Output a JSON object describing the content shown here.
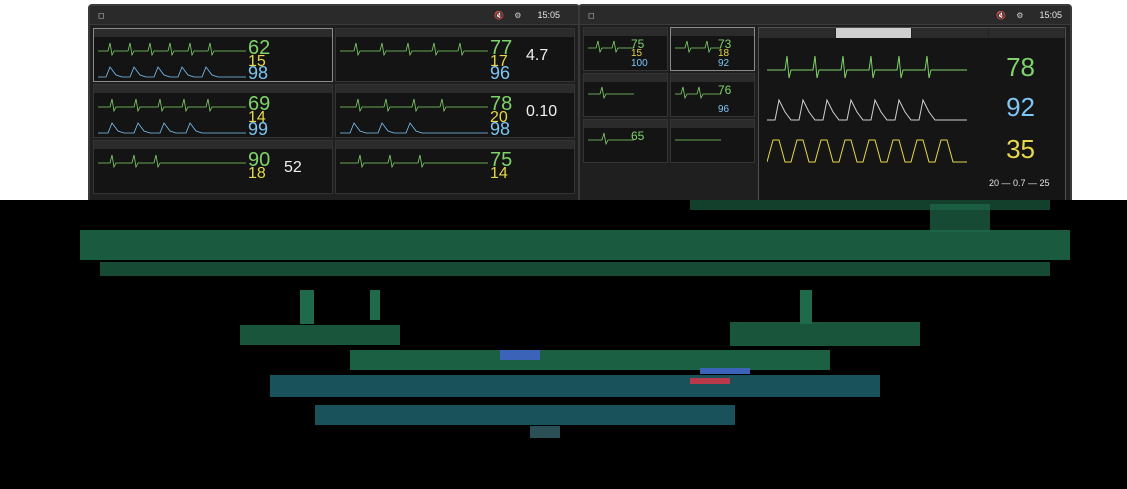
{
  "left_monitor": {
    "brand": "",
    "buttons": [
      "",
      ""
    ],
    "clock": "15:05",
    "date": "",
    "tiles": [
      {
        "hr": "62",
        "rr": "15",
        "sp": "98",
        "extra": ""
      },
      {
        "hr": "77",
        "rr": "17",
        "sp": "96",
        "extra": "4.7"
      },
      {
        "hr": "69",
        "rr": "14",
        "sp": "99",
        "extra": ""
      },
      {
        "hr": "78",
        "rr": "20",
        "sp": "98",
        "extra": "0.10"
      },
      {
        "hr": "90",
        "rr": "18",
        "sp": "",
        "extra": "52"
      },
      {
        "hr": "75",
        "rr": "14",
        "sp": "",
        "extra": ""
      }
    ]
  },
  "right_monitor": {
    "brand": "",
    "clock": "15:05",
    "mini_tiles": [
      {
        "hr": "75",
        "rr": "15",
        "sp": "100"
      },
      {
        "hr": "73",
        "rr": "18",
        "sp": "92"
      },
      {
        "hr": "",
        "rr": "",
        "sp": ""
      },
      {
        "hr": "76",
        "rr": "",
        "sp": "96"
      },
      {
        "hr": "65",
        "rr": "",
        "sp": ""
      },
      {
        "hr": "",
        "rr": "",
        "sp": ""
      }
    ],
    "detail": {
      "tabs": [
        "",
        "",
        "",
        ""
      ],
      "hr": "78",
      "sp": "92",
      "rr": "35",
      "pressure": "20 — 0.7 — 25"
    }
  },
  "colors": {
    "hr": "#7fd36a",
    "rr": "#e6d84a",
    "spo2": "#7ec6f5",
    "overlay": "#000000",
    "glitch_green": "#1f6a4a",
    "glitch_teal": "#1d5b66"
  }
}
